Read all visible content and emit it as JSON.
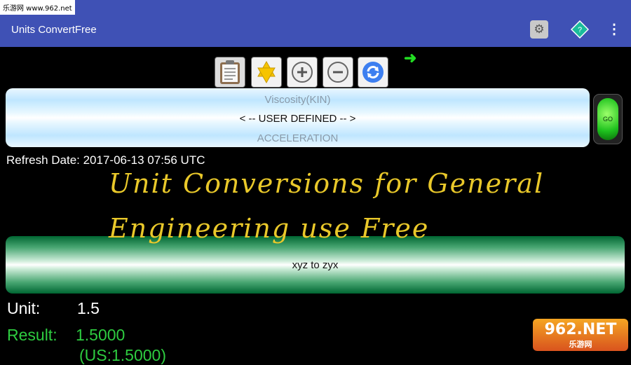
{
  "watermark_top": "乐游网 www.962.net",
  "app": {
    "title": "Units ConvertFree"
  },
  "appbar_icons": [
    "gear-icon",
    "help-icon",
    "overflow-menu-icon"
  ],
  "toolbar": {
    "icons": [
      "clipboard-icon",
      "star-icon",
      "zoom-in-icon",
      "zoom-out-icon",
      "refresh-icon"
    ]
  },
  "picker": {
    "prev": "Viscosity(KIN)",
    "selected": "< -- USER DEFINED -- >",
    "next": "ACCELERATION"
  },
  "go_button": {
    "label": "GO"
  },
  "refresh_date": "Refresh Date: 2017-06-13 07:56 UTC",
  "overlay": {
    "line1": "Unit Conversions for General",
    "line2": "Engineering use Free"
  },
  "conversion": {
    "label": "xyz to zyx"
  },
  "unit": {
    "label": "Unit:",
    "value": "1.5"
  },
  "result": {
    "label": "Result:",
    "value": "1.5000",
    "us": "(US:1.5000)"
  },
  "watermark_bottom": {
    "main": "962.NET",
    "sub": "乐游网"
  },
  "colors": {
    "appbar": "#3f51b5",
    "result": "#2ecc40",
    "overlay": "#e9c82a"
  }
}
